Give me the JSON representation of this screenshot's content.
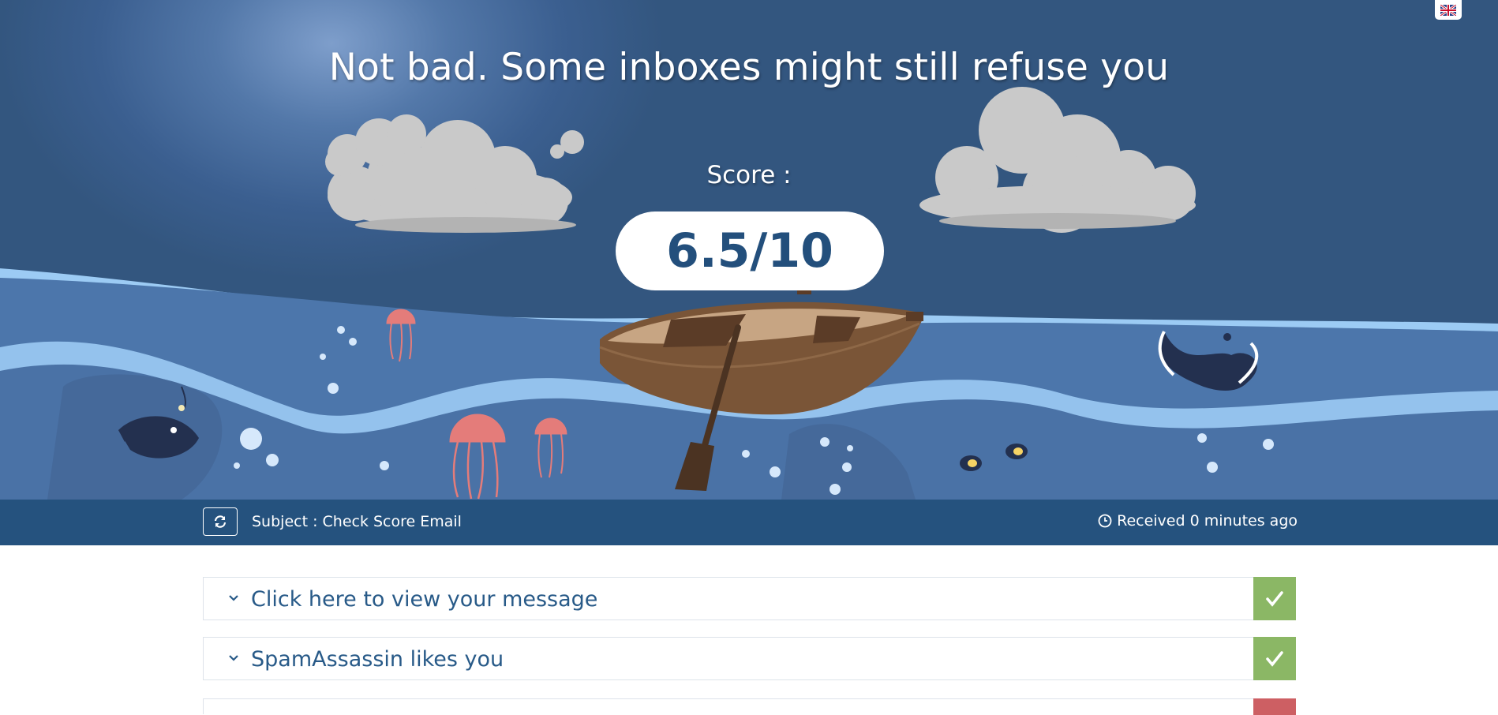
{
  "hero": {
    "headline": "Not bad. Some inboxes might still refuse you",
    "score_label": "Score :",
    "score_value": "6.5/10"
  },
  "language": {
    "icon": "uk-flag-icon"
  },
  "subject_bar": {
    "refresh_icon": "refresh-icon",
    "subject": "Subject : Check Score Email",
    "received_icon": "clock-icon",
    "received": "Received 0 minutes ago"
  },
  "checks": [
    {
      "label": "Click here to view your message",
      "status": "pass",
      "icon": "checkmark-icon"
    },
    {
      "label": "SpamAssassin likes you",
      "status": "pass",
      "icon": "checkmark-icon"
    },
    {
      "label": "",
      "status": "fail",
      "icon": "cross-icon"
    }
  ],
  "colors": {
    "sky": "#33567f",
    "bar": "#25527e",
    "pass": "#8bb765",
    "fail": "#cd5f63",
    "score_text": "#234f7c"
  }
}
